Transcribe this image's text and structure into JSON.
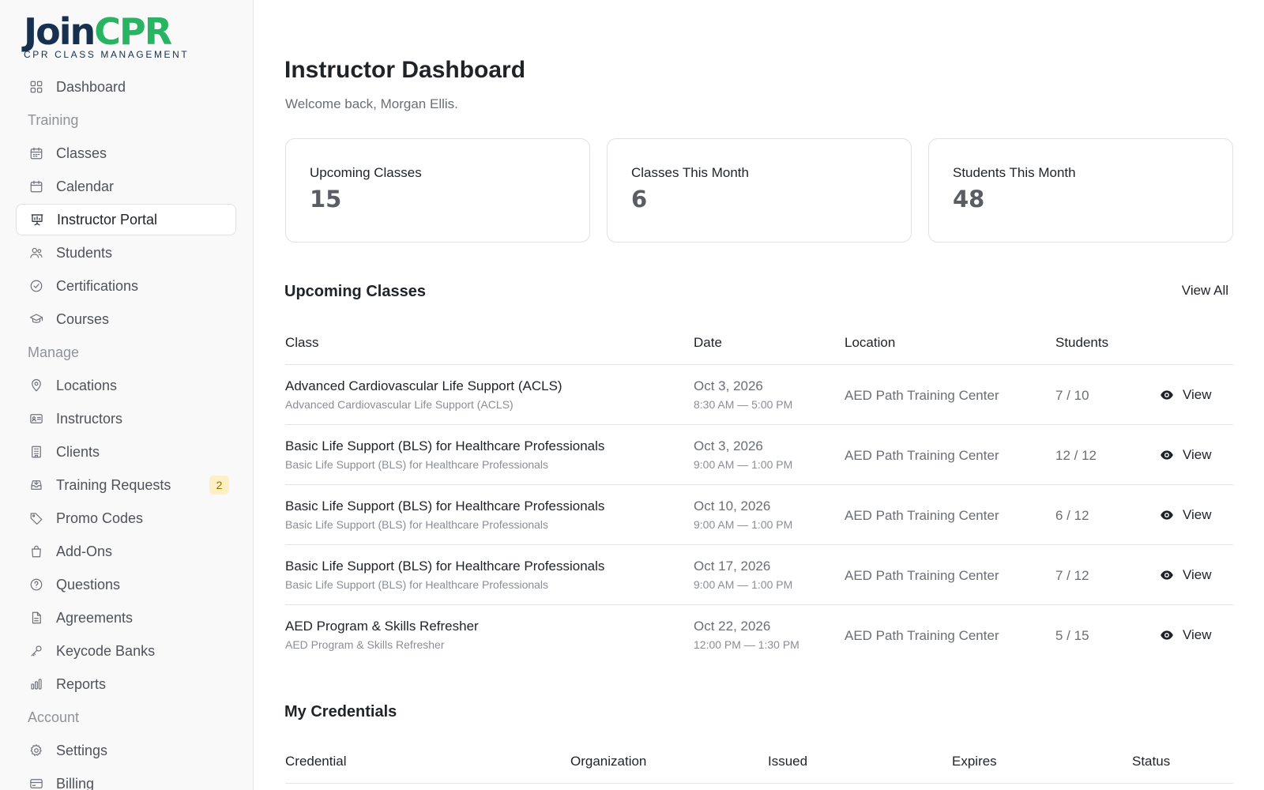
{
  "brand": {
    "name_part1": "Join",
    "name_part2": "CPR",
    "tagline": "CPR CLASS MANAGEMENT",
    "color_dark": "#17304d",
    "color_accent": "#28b463"
  },
  "sidebar": {
    "items": [
      {
        "type": "item",
        "label": "Dashboard",
        "icon": "grid-icon"
      },
      {
        "type": "section",
        "label": "Training"
      },
      {
        "type": "item",
        "label": "Classes",
        "icon": "calendar-grid-icon"
      },
      {
        "type": "item",
        "label": "Calendar",
        "icon": "calendar-icon"
      },
      {
        "type": "item",
        "label": "Instructor Portal",
        "icon": "presentation-icon",
        "active": true
      },
      {
        "type": "item",
        "label": "Students",
        "icon": "users-icon"
      },
      {
        "type": "item",
        "label": "Certifications",
        "icon": "badge-check-icon"
      },
      {
        "type": "item",
        "label": "Courses",
        "icon": "graduation-cap-icon"
      },
      {
        "type": "section",
        "label": "Manage"
      },
      {
        "type": "item",
        "label": "Locations",
        "icon": "map-pin-icon"
      },
      {
        "type": "item",
        "label": "Instructors",
        "icon": "id-card-icon"
      },
      {
        "type": "item",
        "label": "Clients",
        "icon": "building-icon"
      },
      {
        "type": "item",
        "label": "Training Requests",
        "icon": "inbox-icon",
        "badge": "2"
      },
      {
        "type": "item",
        "label": "Promo Codes",
        "icon": "tag-icon"
      },
      {
        "type": "item",
        "label": "Add-Ons",
        "icon": "shopping-bag-icon"
      },
      {
        "type": "item",
        "label": "Questions",
        "icon": "help-circle-icon"
      },
      {
        "type": "item",
        "label": "Agreements",
        "icon": "file-text-icon"
      },
      {
        "type": "item",
        "label": "Keycode Banks",
        "icon": "key-icon"
      },
      {
        "type": "item",
        "label": "Reports",
        "icon": "bar-chart-icon"
      },
      {
        "type": "section",
        "label": "Account"
      },
      {
        "type": "item",
        "label": "Settings",
        "icon": "gear-icon"
      },
      {
        "type": "item",
        "label": "Billing",
        "icon": "credit-card-icon"
      }
    ]
  },
  "header": {
    "title": "Instructor Dashboard",
    "welcome": "Welcome back, Morgan Ellis."
  },
  "stats": [
    {
      "label": "Upcoming Classes",
      "value": "15"
    },
    {
      "label": "Classes This Month",
      "value": "6"
    },
    {
      "label": "Students This Month",
      "value": "48"
    }
  ],
  "upcoming": {
    "title": "Upcoming Classes",
    "view_all": "View All",
    "columns": [
      "Class",
      "Date",
      "Location",
      "Students"
    ],
    "action_label": "View",
    "rows": [
      {
        "class": "Advanced Cardiovascular Life Support (ACLS)",
        "course": "Advanced Cardiovascular Life Support (ACLS)",
        "date": "Oct 3, 2026",
        "time": "8:30 AM — 5:00 PM",
        "location": "AED Path Training Center",
        "students": "7 / 10"
      },
      {
        "class": "Basic Life Support (BLS) for Healthcare Professionals",
        "course": "Basic Life Support (BLS) for Healthcare Professionals",
        "date": "Oct 3, 2026",
        "time": "9:00 AM — 1:00 PM",
        "location": "AED Path Training Center",
        "students": "12 / 12"
      },
      {
        "class": "Basic Life Support (BLS) for Healthcare Professionals",
        "course": "Basic Life Support (BLS) for Healthcare Professionals",
        "date": "Oct 10, 2026",
        "time": "9:00 AM — 1:00 PM",
        "location": "AED Path Training Center",
        "students": "6 / 12"
      },
      {
        "class": "Basic Life Support (BLS) for Healthcare Professionals",
        "course": "Basic Life Support (BLS) for Healthcare Professionals",
        "date": "Oct 17, 2026",
        "time": "9:00 AM — 1:00 PM",
        "location": "AED Path Training Center",
        "students": "7 / 12"
      },
      {
        "class": "AED Program & Skills Refresher",
        "course": "AED Program & Skills Refresher",
        "date": "Oct 22, 2026",
        "time": "12:00 PM — 1:30 PM",
        "location": "AED Path Training Center",
        "students": "5 / 15"
      }
    ]
  },
  "credentials": {
    "title": "My Credentials",
    "columns": [
      "Credential",
      "Organization",
      "Issued",
      "Expires",
      "Status"
    ]
  }
}
